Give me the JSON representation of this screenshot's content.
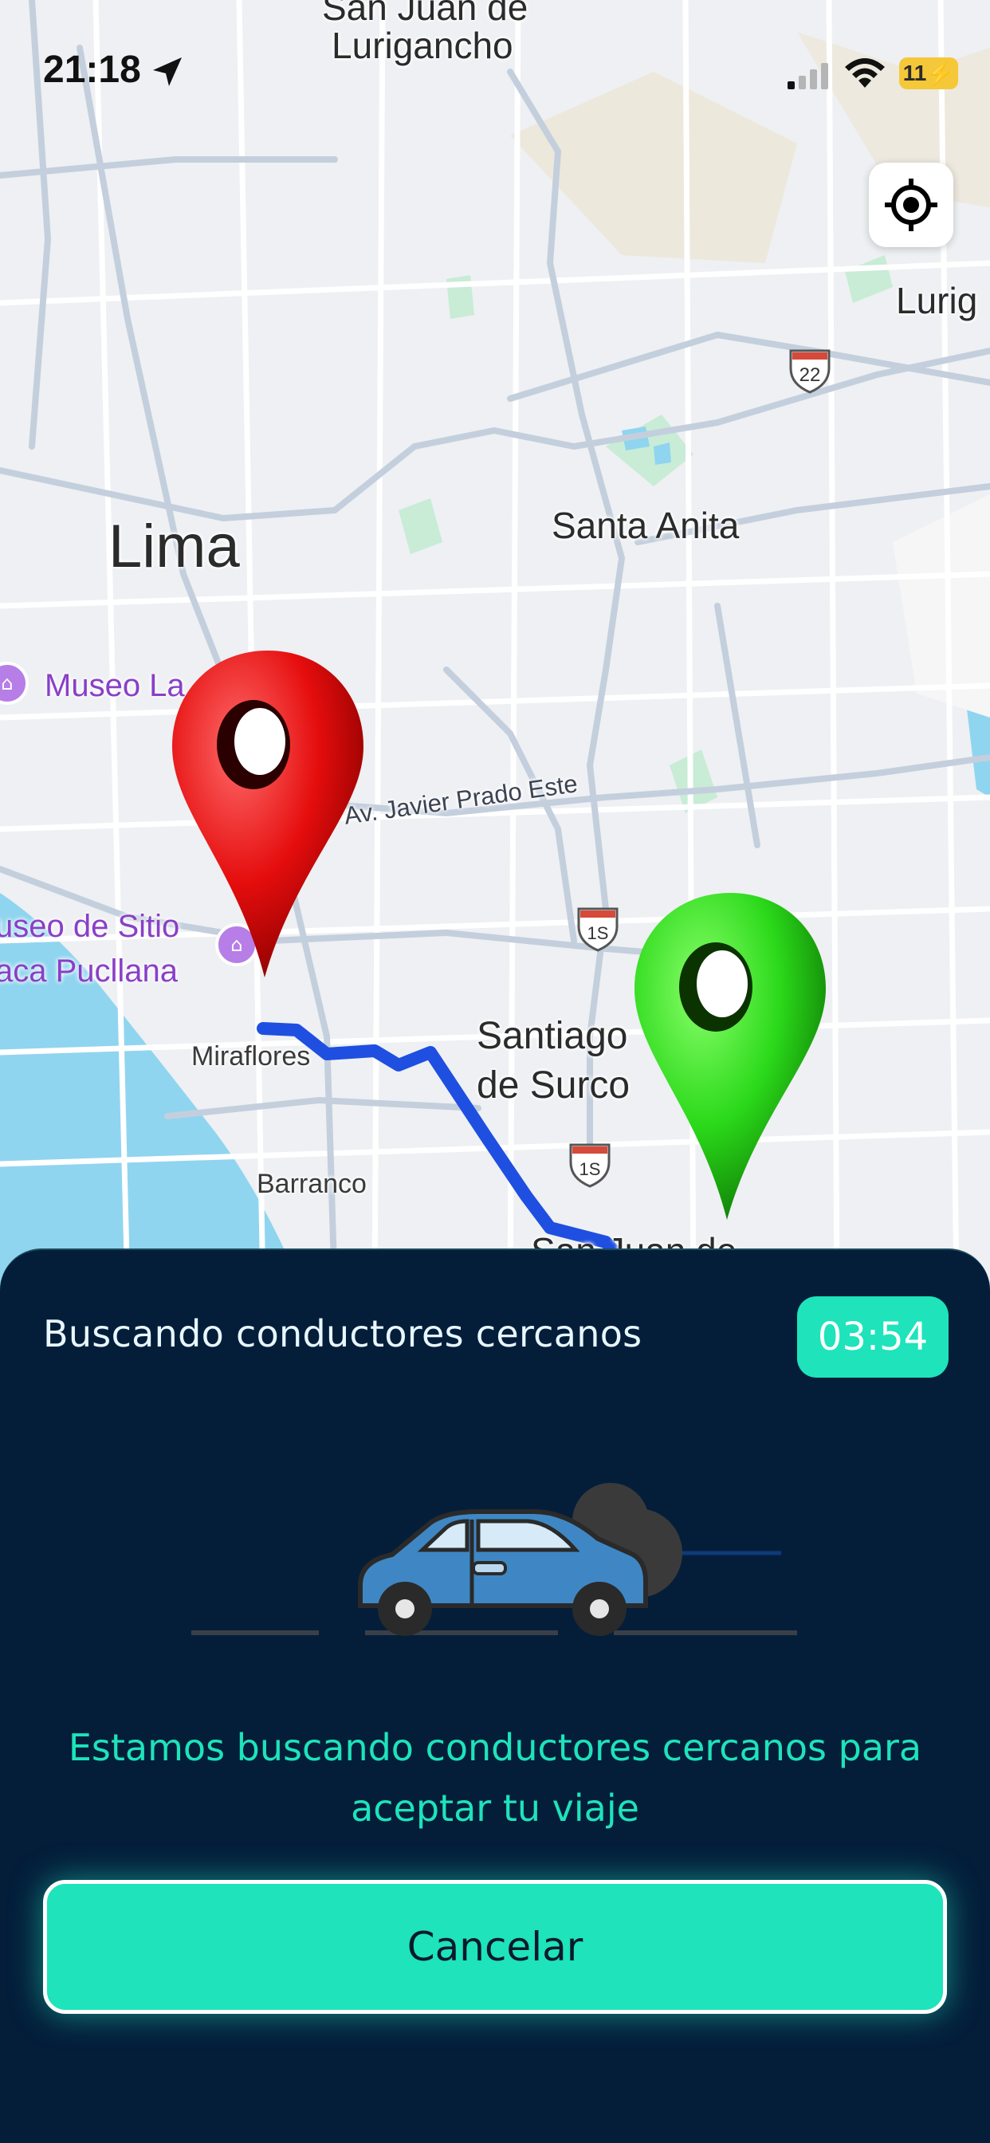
{
  "status_bar": {
    "time": "21:18",
    "battery": "11"
  },
  "map": {
    "labels": {
      "san_juan_top": "San Juan de",
      "lurigancho": "Lurigancho",
      "lurig_edge": "Lurig",
      "lima": "Lima",
      "santa_anita": "Santa Anita",
      "javier_prado": "Av. Javier Prado Este",
      "santiago_1": "Santiago",
      "santiago_2": "de Surco",
      "miraflores": "Miraflores",
      "barranco": "Barranco",
      "sjm": "San Juan de"
    },
    "pois": {
      "museo_1": "Museo La",
      "museo_2a": "useo de Sitio",
      "museo_2b": "aca Pucllana"
    },
    "shields": {
      "s22": "22",
      "s1a": "1S",
      "s1b": "1S"
    },
    "colors": {
      "route": "#1f4fe0",
      "water": "#8fd5ef",
      "park": "#c8ecd6",
      "road": "#c9d4e3"
    }
  },
  "sheet": {
    "title": "Buscando conductores cercanos",
    "timer": "03:54",
    "message": "Estamos buscando conductores cercanos para aceptar tu viaje",
    "cancel_label": "Cancelar",
    "colors": {
      "background": "#041e3a",
      "accent": "#1ee3bb"
    }
  },
  "icons": {
    "location_arrow": "location-arrow-icon",
    "locate": "crosshair-icon",
    "origin_pin": "red-pin-icon",
    "destination_pin": "green-pin-icon",
    "car": "car-icon"
  }
}
